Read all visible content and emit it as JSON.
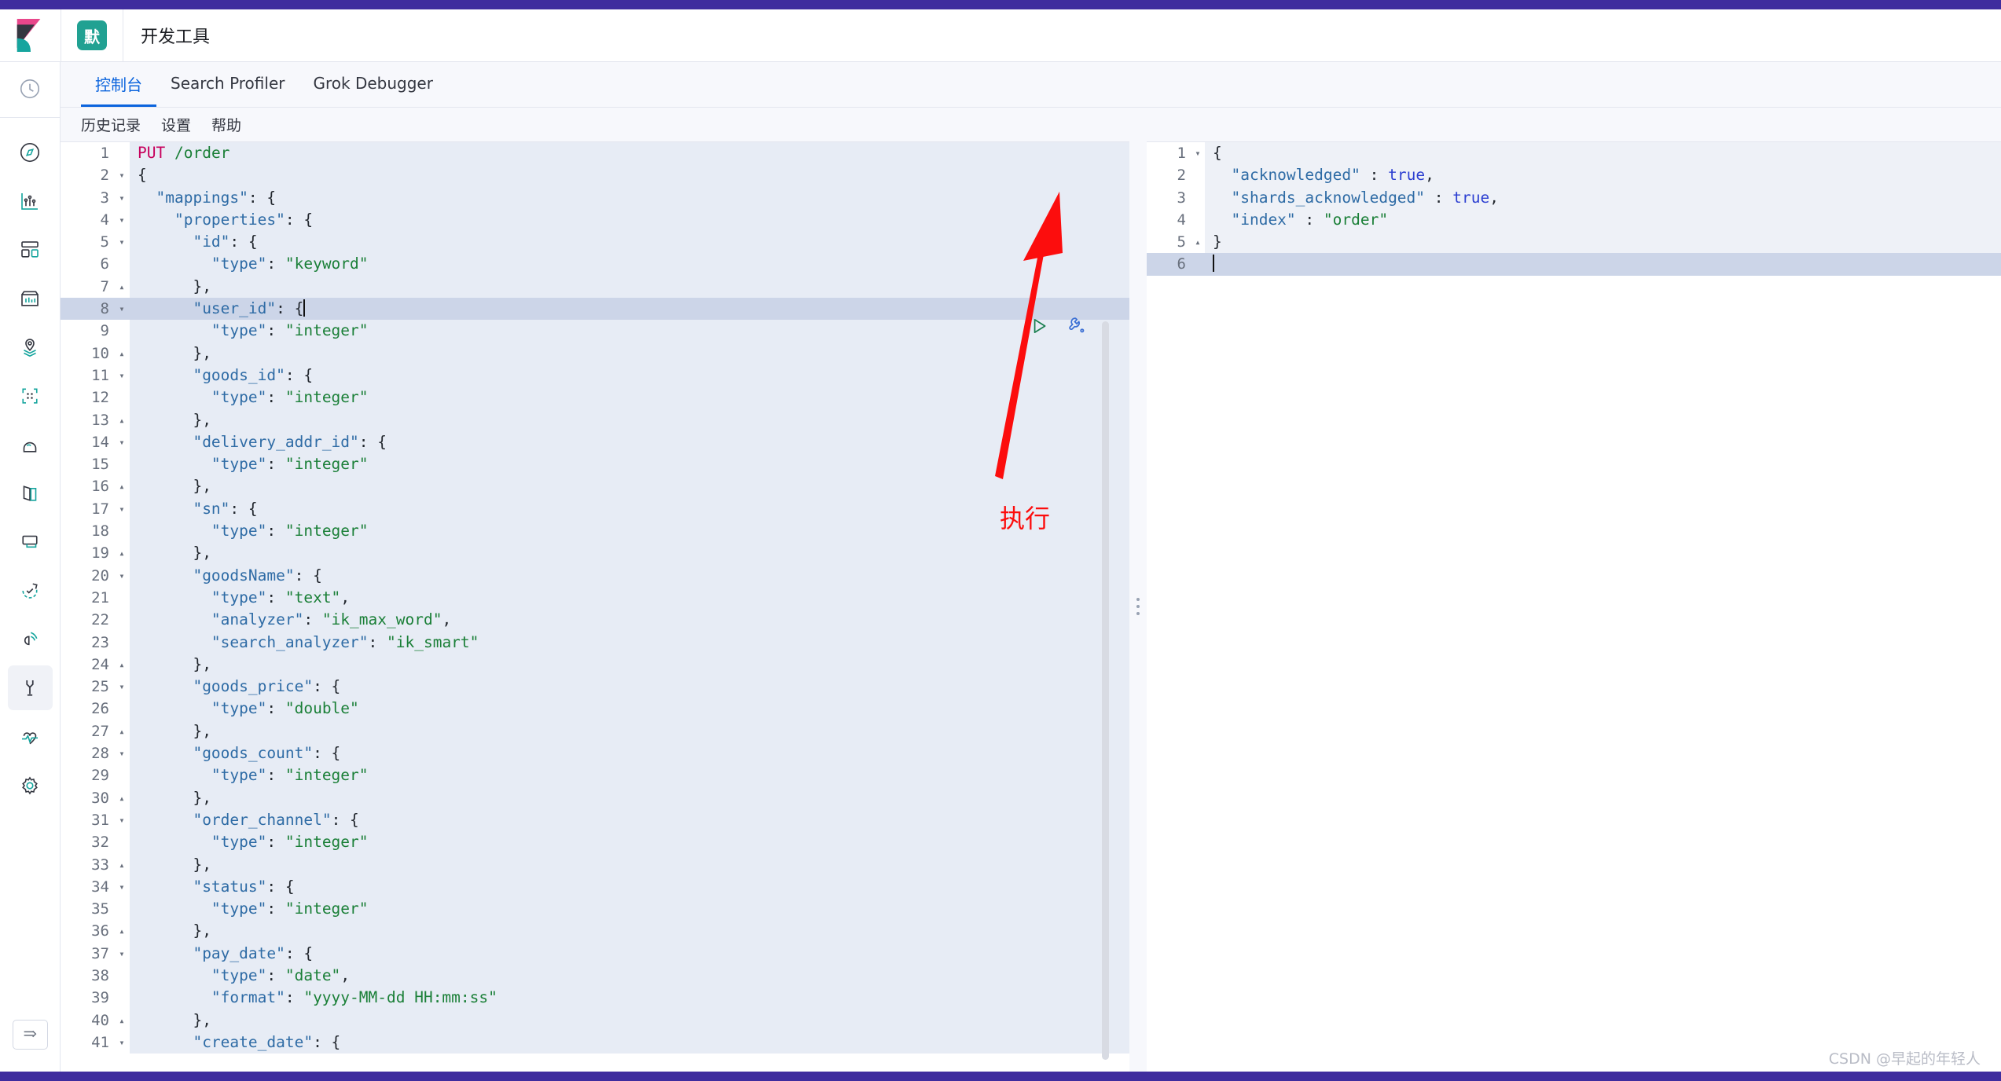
{
  "header": {
    "logo_icon": "kibana-logo",
    "space_badge": "默",
    "app_title": "开发工具"
  },
  "nav": {
    "items": [
      {
        "icon": "clock-icon",
        "name": "recently-viewed"
      },
      {
        "icon": "compass-icon",
        "name": "discover"
      },
      {
        "icon": "visualize-icon",
        "name": "visualize"
      },
      {
        "icon": "dashboard-icon",
        "name": "dashboard"
      },
      {
        "icon": "canvas-icon",
        "name": "canvas"
      },
      {
        "icon": "maps-icon",
        "name": "maps"
      },
      {
        "icon": "machine-learning-icon",
        "name": "machine-learning"
      },
      {
        "icon": "infrastructure-icon",
        "name": "infrastructure"
      },
      {
        "icon": "logs-icon",
        "name": "logs"
      },
      {
        "icon": "apm-icon",
        "name": "apm"
      },
      {
        "icon": "uptime-icon",
        "name": "uptime"
      },
      {
        "icon": "siem-icon",
        "name": "siem"
      },
      {
        "icon": "wrench-icon",
        "name": "dev-tools",
        "active": true
      },
      {
        "icon": "monitoring-icon",
        "name": "monitoring"
      },
      {
        "icon": "gear-icon",
        "name": "management"
      }
    ],
    "collapse_icon": "collapse-icon"
  },
  "tabs": [
    {
      "label": "控制台",
      "active": true
    },
    {
      "label": "Search Profiler",
      "active": false
    },
    {
      "label": "Grok Debugger",
      "active": false
    }
  ],
  "submenu": [
    "历史记录",
    "设置",
    "帮助"
  ],
  "editor": {
    "play_icon": "play-icon",
    "wrench_icon": "wrench-icon",
    "lines": [
      {
        "n": 1,
        "fold": "",
        "html": "<span class=\"tok-method\">PUT</span> <span class=\"tok-url\">/order</span>"
      },
      {
        "n": 2,
        "fold": "▾",
        "html": "<span class=\"tok-punc\">{</span>"
      },
      {
        "n": 3,
        "fold": "▾",
        "html": "  <span class=\"tok-key\">\"mappings\"</span><span class=\"tok-punc\">: {</span>"
      },
      {
        "n": 4,
        "fold": "▾",
        "html": "    <span class=\"tok-key\">\"properties\"</span><span class=\"tok-punc\">: {</span>"
      },
      {
        "n": 5,
        "fold": "▾",
        "html": "      <span class=\"tok-key\">\"id\"</span><span class=\"tok-punc\">: {</span>"
      },
      {
        "n": 6,
        "fold": "",
        "html": "        <span class=\"tok-key\">\"type\"</span><span class=\"tok-punc\">: </span><span class=\"tok-str\">\"keyword\"</span>"
      },
      {
        "n": 7,
        "fold": "▴",
        "html": "      <span class=\"tok-punc\">},</span>"
      },
      {
        "n": 8,
        "fold": "▾",
        "html": "      <span class=\"tok-key\">\"user_id\"</span><span class=\"tok-punc\">: {</span><span class=\"cursor\"></span>",
        "highlight": true
      },
      {
        "n": 9,
        "fold": "",
        "html": "        <span class=\"tok-key\">\"type\"</span><span class=\"tok-punc\">: </span><span class=\"tok-str\">\"integer\"</span>"
      },
      {
        "n": 10,
        "fold": "▴",
        "html": "      <span class=\"tok-punc\">},</span>"
      },
      {
        "n": 11,
        "fold": "▾",
        "html": "      <span class=\"tok-key\">\"goods_id\"</span><span class=\"tok-punc\">: {</span>"
      },
      {
        "n": 12,
        "fold": "",
        "html": "        <span class=\"tok-key\">\"type\"</span><span class=\"tok-punc\">: </span><span class=\"tok-str\">\"integer\"</span>"
      },
      {
        "n": 13,
        "fold": "▴",
        "html": "      <span class=\"tok-punc\">},</span>"
      },
      {
        "n": 14,
        "fold": "▾",
        "html": "      <span class=\"tok-key\">\"delivery_addr_id\"</span><span class=\"tok-punc\">: {</span>"
      },
      {
        "n": 15,
        "fold": "",
        "html": "        <span class=\"tok-key\">\"type\"</span><span class=\"tok-punc\">: </span><span class=\"tok-str\">\"integer\"</span>"
      },
      {
        "n": 16,
        "fold": "▴",
        "html": "      <span class=\"tok-punc\">},</span>"
      },
      {
        "n": 17,
        "fold": "▾",
        "html": "      <span class=\"tok-key\">\"sn\"</span><span class=\"tok-punc\">: {</span>"
      },
      {
        "n": 18,
        "fold": "",
        "html": "        <span class=\"tok-key\">\"type\"</span><span class=\"tok-punc\">: </span><span class=\"tok-str\">\"integer\"</span>"
      },
      {
        "n": 19,
        "fold": "▴",
        "html": "      <span class=\"tok-punc\">},</span>"
      },
      {
        "n": 20,
        "fold": "▾",
        "html": "      <span class=\"tok-key\">\"goodsName\"</span><span class=\"tok-punc\">: {</span>"
      },
      {
        "n": 21,
        "fold": "",
        "html": "        <span class=\"tok-key\">\"type\"</span><span class=\"tok-punc\">: </span><span class=\"tok-str\">\"text\"</span><span class=\"tok-punc\">,</span>"
      },
      {
        "n": 22,
        "fold": "",
        "html": "        <span class=\"tok-key\">\"analyzer\"</span><span class=\"tok-punc\">: </span><span class=\"tok-str\">\"ik_max_word\"</span><span class=\"tok-punc\">,</span>"
      },
      {
        "n": 23,
        "fold": "",
        "html": "        <span class=\"tok-key\">\"search_analyzer\"</span><span class=\"tok-punc\">: </span><span class=\"tok-str\">\"ik_smart\"</span>"
      },
      {
        "n": 24,
        "fold": "▴",
        "html": "      <span class=\"tok-punc\">},</span>"
      },
      {
        "n": 25,
        "fold": "▾",
        "html": "      <span class=\"tok-key\">\"goods_price\"</span><span class=\"tok-punc\">: {</span>"
      },
      {
        "n": 26,
        "fold": "",
        "html": "        <span class=\"tok-key\">\"type\"</span><span class=\"tok-punc\">: </span><span class=\"tok-str\">\"double\"</span>"
      },
      {
        "n": 27,
        "fold": "▴",
        "html": "      <span class=\"tok-punc\">},</span>"
      },
      {
        "n": 28,
        "fold": "▾",
        "html": "      <span class=\"tok-key\">\"goods_count\"</span><span class=\"tok-punc\">: {</span>"
      },
      {
        "n": 29,
        "fold": "",
        "html": "        <span class=\"tok-key\">\"type\"</span><span class=\"tok-punc\">: </span><span class=\"tok-str\">\"integer\"</span>"
      },
      {
        "n": 30,
        "fold": "▴",
        "html": "      <span class=\"tok-punc\">},</span>"
      },
      {
        "n": 31,
        "fold": "▾",
        "html": "      <span class=\"tok-key\">\"order_channel\"</span><span class=\"tok-punc\">: {</span>"
      },
      {
        "n": 32,
        "fold": "",
        "html": "        <span class=\"tok-key\">\"type\"</span><span class=\"tok-punc\">: </span><span class=\"tok-str\">\"integer\"</span>"
      },
      {
        "n": 33,
        "fold": "▴",
        "html": "      <span class=\"tok-punc\">},</span>"
      },
      {
        "n": 34,
        "fold": "▾",
        "html": "      <span class=\"tok-key\">\"status\"</span><span class=\"tok-punc\">: {</span>"
      },
      {
        "n": 35,
        "fold": "",
        "html": "        <span class=\"tok-key\">\"type\"</span><span class=\"tok-punc\">: </span><span class=\"tok-str\">\"integer\"</span>"
      },
      {
        "n": 36,
        "fold": "▴",
        "html": "      <span class=\"tok-punc\">},</span>"
      },
      {
        "n": 37,
        "fold": "▾",
        "html": "      <span class=\"tok-key\">\"pay_date\"</span><span class=\"tok-punc\">: {</span>"
      },
      {
        "n": 38,
        "fold": "",
        "html": "        <span class=\"tok-key\">\"type\"</span><span class=\"tok-punc\">: </span><span class=\"tok-str\">\"date\"</span><span class=\"tok-punc\">,</span>"
      },
      {
        "n": 39,
        "fold": "",
        "html": "        <span class=\"tok-key\">\"format\"</span><span class=\"tok-punc\">: </span><span class=\"tok-str\">\"yyyy-MM-dd HH:mm:ss\"</span>"
      },
      {
        "n": 40,
        "fold": "▴",
        "html": "      <span class=\"tok-punc\">},</span>"
      },
      {
        "n": 41,
        "fold": "▾",
        "html": "      <span class=\"tok-key\">\"create_date\"</span><span class=\"tok-punc\">: {</span>"
      }
    ]
  },
  "response": {
    "lines": [
      {
        "n": 1,
        "fold": "▾",
        "html": "<span class=\"tok-punc\">{</span>"
      },
      {
        "n": 2,
        "fold": "",
        "html": "  <span class=\"tok-key\">\"acknowledged\"</span><span class=\"tok-punc\"> : </span><span class=\"tok-bool\">true</span><span class=\"tok-punc\">,</span>"
      },
      {
        "n": 3,
        "fold": "",
        "html": "  <span class=\"tok-key\">\"shards_acknowledged\"</span><span class=\"tok-punc\"> : </span><span class=\"tok-bool\">true</span><span class=\"tok-punc\">,</span>"
      },
      {
        "n": 4,
        "fold": "",
        "html": "  <span class=\"tok-key\">\"index\"</span><span class=\"tok-punc\"> : </span><span class=\"tok-str\">\"order\"</span>"
      },
      {
        "n": 5,
        "fold": "▴",
        "html": "<span class=\"tok-punc\">}</span>"
      },
      {
        "n": 6,
        "fold": "",
        "html": "<span class=\"cursor\"></span>",
        "highlight": true
      }
    ]
  },
  "annotation": {
    "label": "执行",
    "color": "#fc0d0d",
    "arrow_icon": "red-arrow-up-icon"
  },
  "watermark": "CSDN @早起的年轻人",
  "colors": {
    "accent": "#0b64dd",
    "brand_purple": "#3f2c9e",
    "space_teal": "#21a192",
    "annotation_red": "#fc0d0d"
  }
}
